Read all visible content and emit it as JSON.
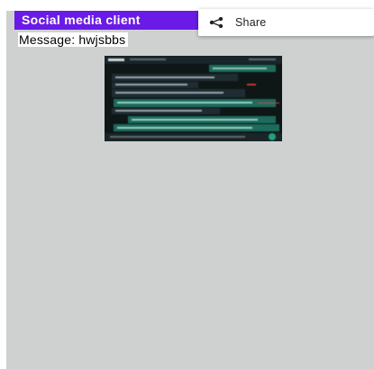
{
  "app_bar": {
    "title": "Social media client",
    "background": "#6a1be5"
  },
  "message": {
    "text": "Message: hwjsbbs"
  },
  "share_menu": {
    "label": "Share",
    "icon": "share-icon"
  },
  "attachment": {
    "description_icon": "chat-screenshot-image"
  },
  "colors": {
    "surface": "#cfd1d1",
    "app_bar": "#6a1be5",
    "bubble_green": "#1d6b5d",
    "bubble_dark": "#1f2c33",
    "image_bg": "#0e1716"
  }
}
